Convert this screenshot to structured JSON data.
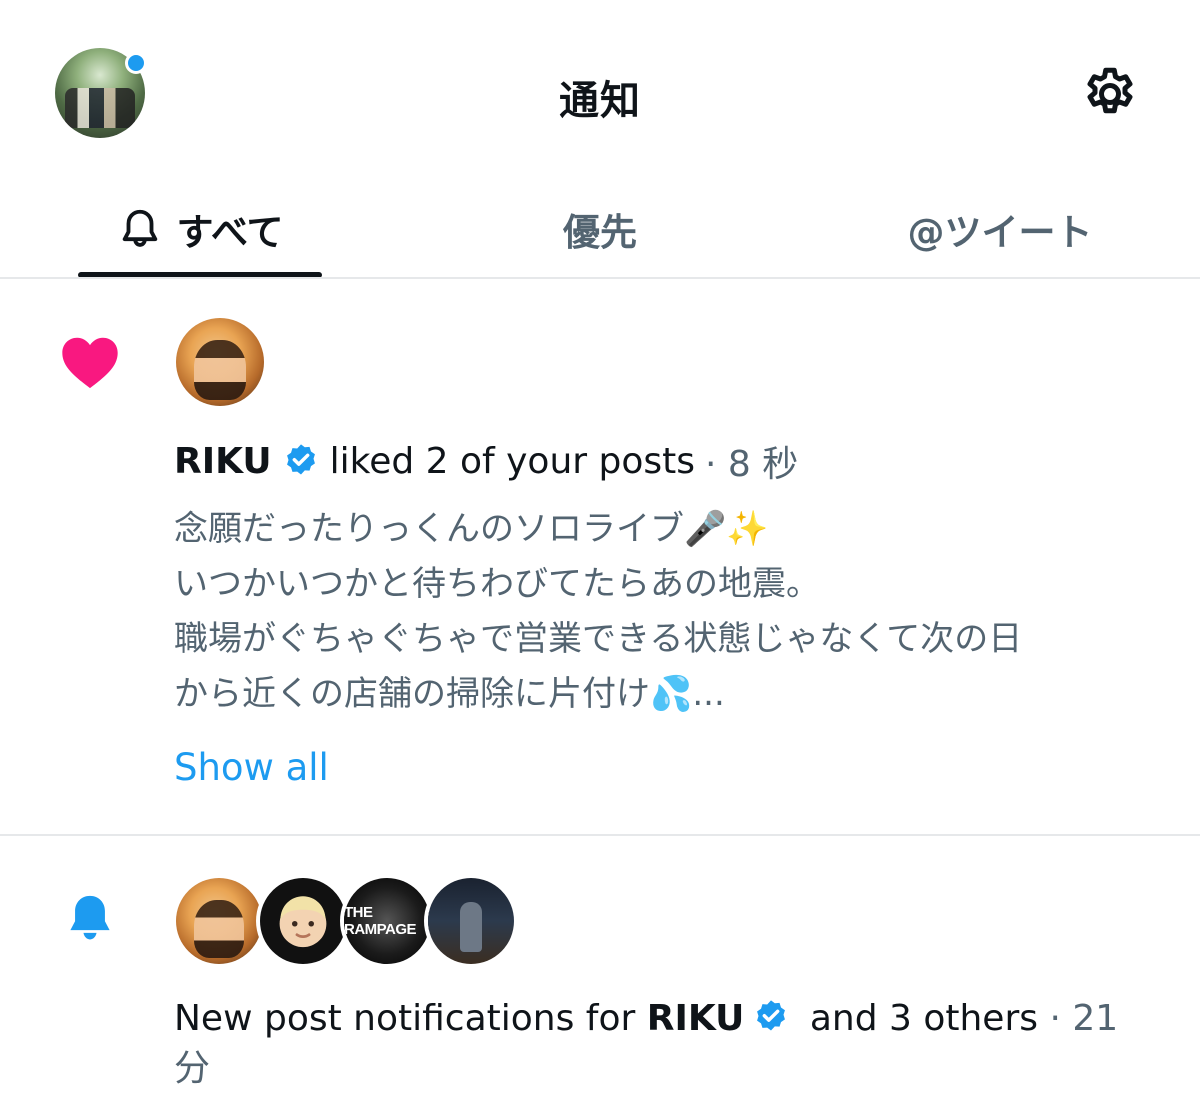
{
  "header": {
    "title": "通知",
    "settings_icon": "gear-icon",
    "unread_indicator_color": "#1d9bf0"
  },
  "tabs": [
    {
      "label": "すべて",
      "icon": "bell-outline-icon",
      "active": true
    },
    {
      "label": "優先",
      "active": false
    },
    {
      "label": "@ツイート",
      "active": false
    }
  ],
  "notifications": [
    {
      "type": "like",
      "icon": "heart-icon",
      "icon_color": "#f91880",
      "user": "RIKU",
      "verified": true,
      "action": "liked 2 of your posts",
      "time": "· 8 秒",
      "post_lines": [
        "念願だったりっくんのソロライブ🎤✨",
        "いつかいつかと待ちわびてたらあの地震。",
        "職場がぐちゃぐちゃで営業できる状態じゃなくて次の日",
        "から近くの店舗の掃除に片付け💦..."
      ],
      "show_all": "Show all"
    },
    {
      "type": "subscription",
      "icon": "bell-icon",
      "icon_color": "#1d9bf0",
      "prefix": "New post notifications for ",
      "user": "RIKU",
      "verified": true,
      "suffix": " and 3 others",
      "time_line1": " · 21",
      "time_line2": "分",
      "avatar_3_label": "THE RAMPAGE"
    }
  ],
  "colors": {
    "accent": "#1d9bf0",
    "like": "#f91880",
    "text_primary": "#0f1419",
    "text_secondary": "#536471"
  }
}
